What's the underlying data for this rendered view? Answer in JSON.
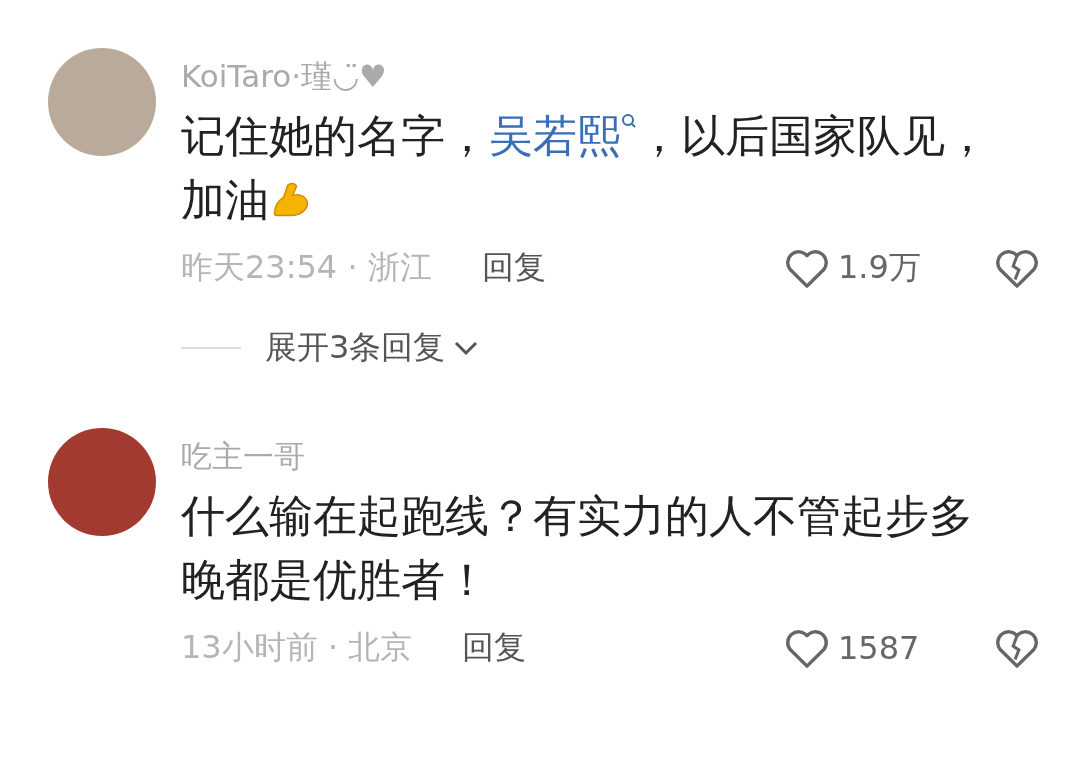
{
  "comments": [
    {
      "username": "KoiTaro·瑾◡̈♥",
      "body": [
        {
          "kind": "text",
          "text": "记住她的名字，"
        },
        {
          "kind": "link",
          "text": "吴若熙"
        },
        {
          "kind": "text",
          "text": "，以后国家队见，加油"
        },
        {
          "kind": "emoji"
        }
      ],
      "time": "昨天23:54 · 浙江",
      "reply": "回复",
      "likes": "1.9万",
      "expand": "展开3条回复"
    },
    {
      "username": "吃主一哥",
      "body": [
        {
          "kind": "text",
          "text": "什么输在起跑线？有实力的人不管起步多晚都是优胜者！"
        }
      ],
      "time": "13小时前 · 北京",
      "reply": "回复",
      "likes": "1587"
    }
  ]
}
